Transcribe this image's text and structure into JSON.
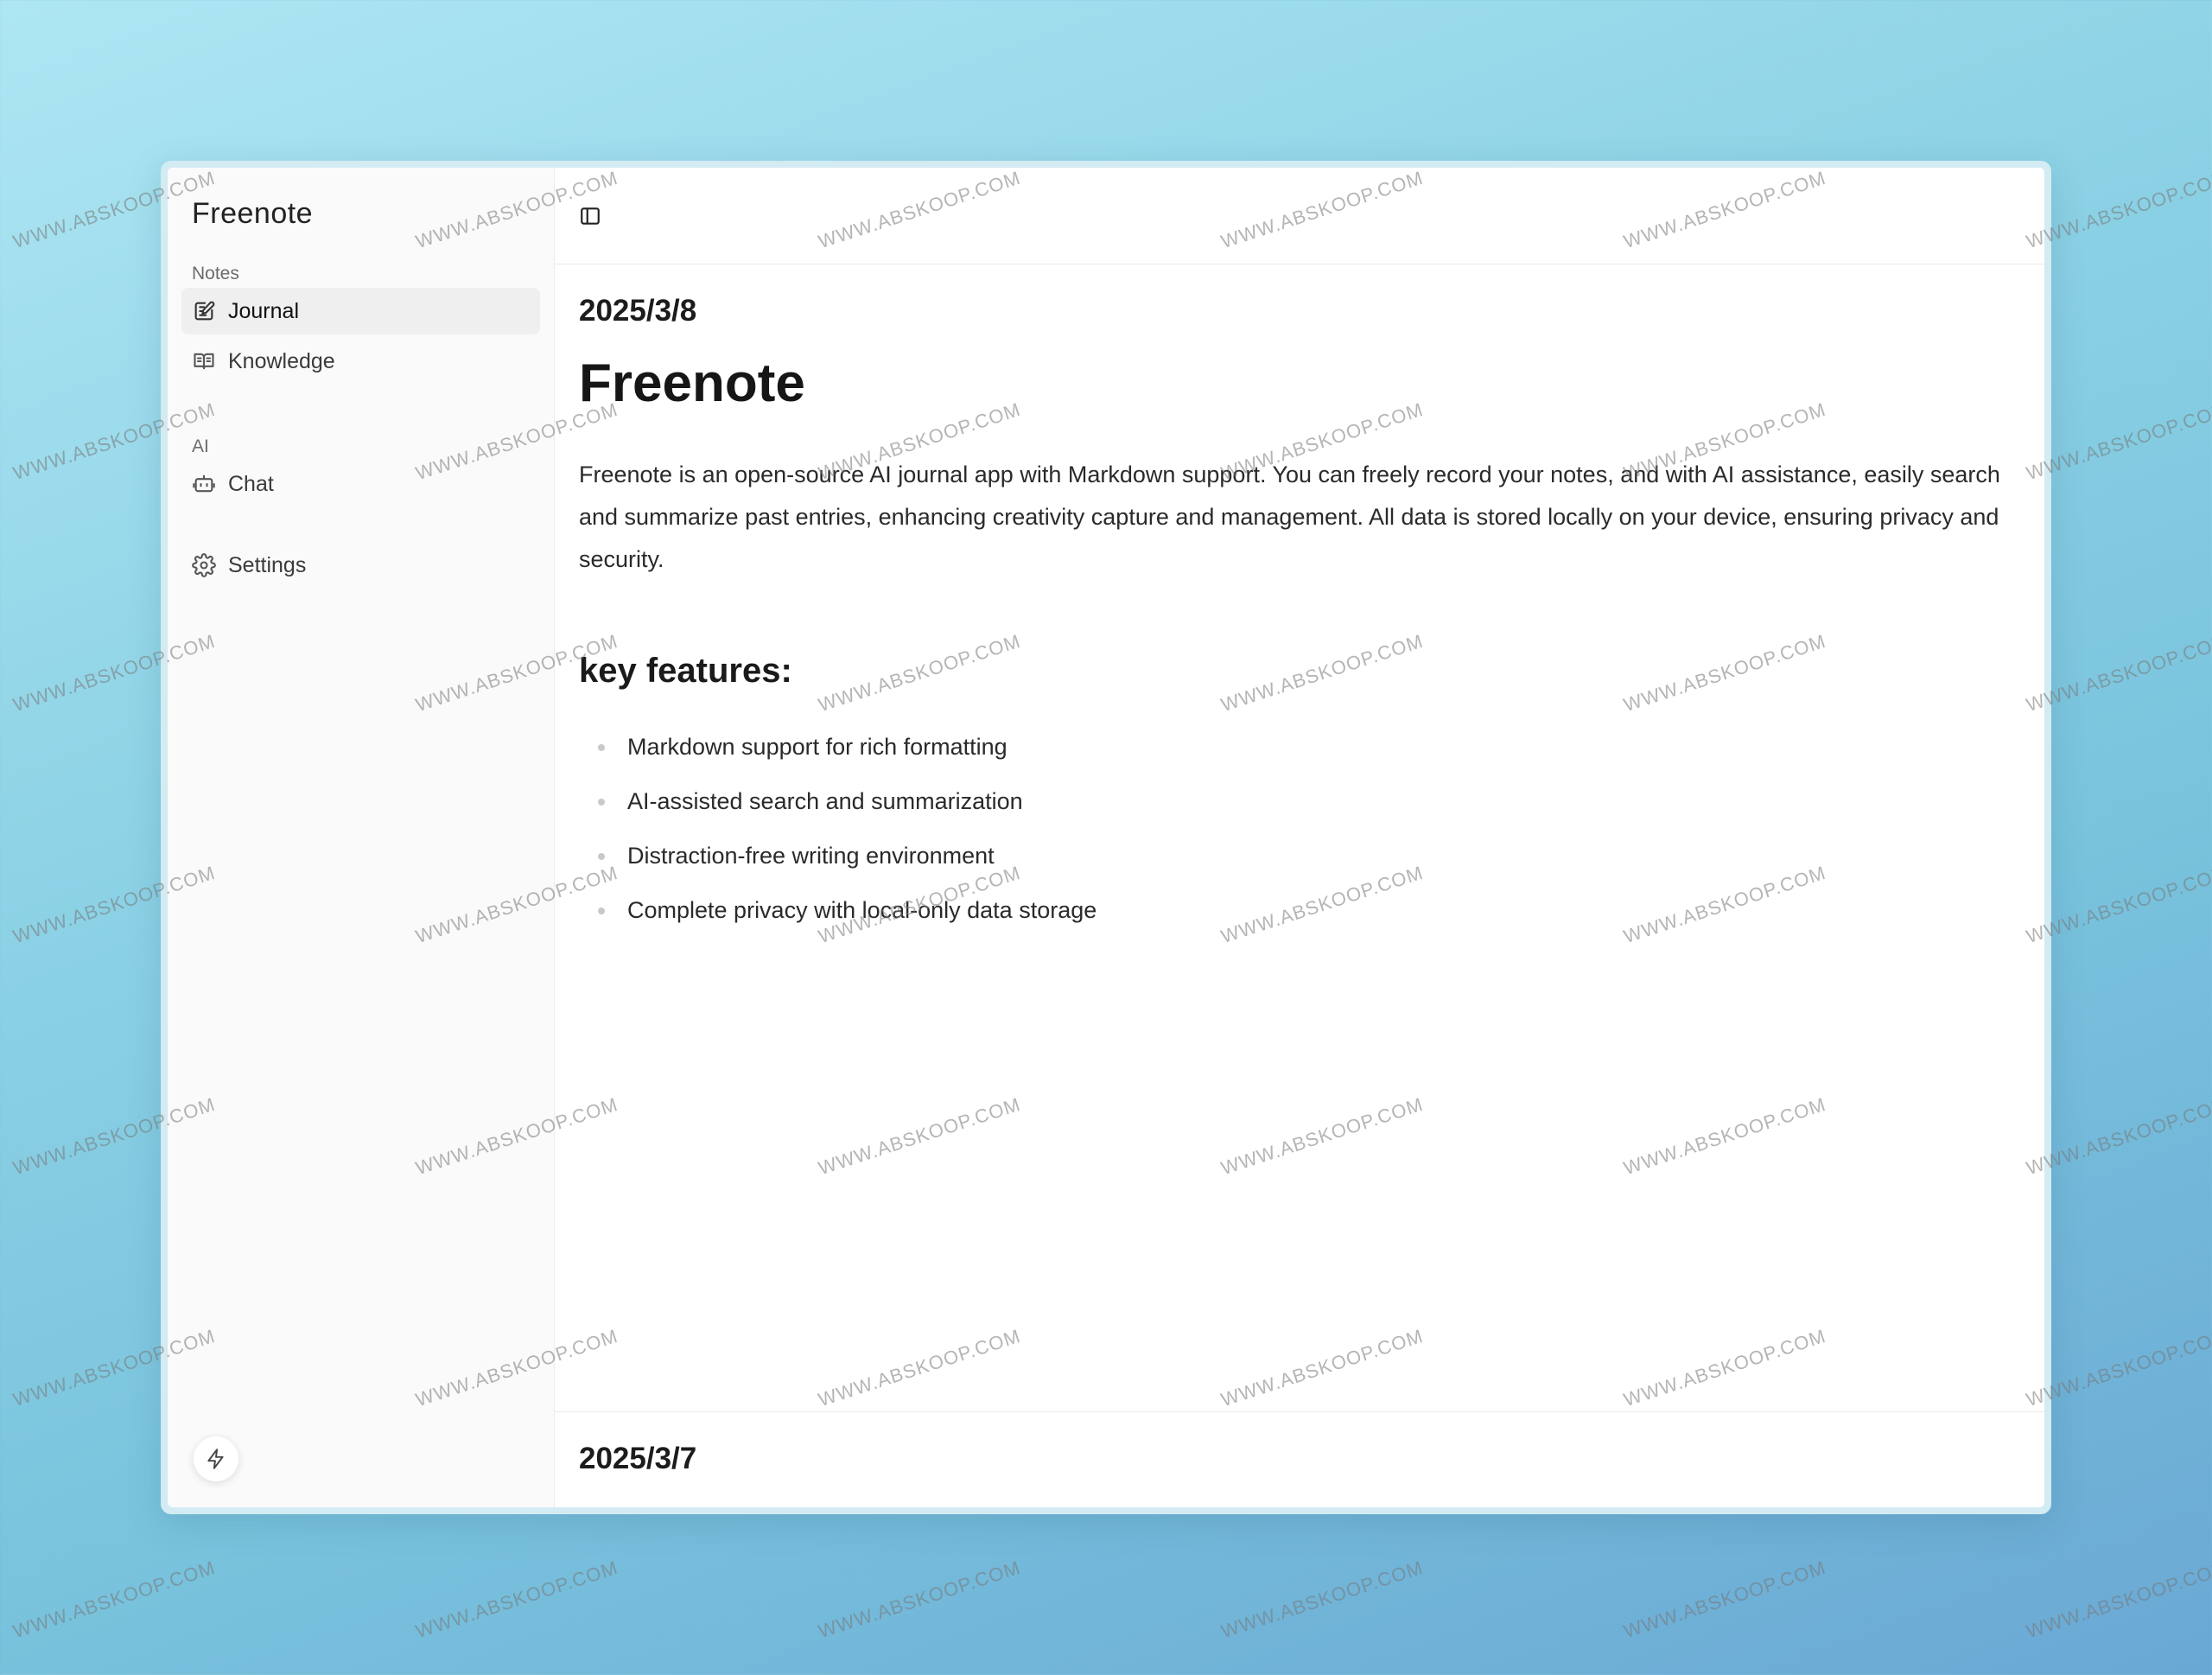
{
  "sidebar": {
    "app_title": "Freenote",
    "sections": {
      "notes_label": "Notes",
      "ai_label": "AI"
    },
    "items": {
      "journal": "Journal",
      "knowledge": "Knowledge",
      "chat": "Chat",
      "settings": "Settings"
    },
    "active_item": "Journal"
  },
  "entries": [
    {
      "date": "2025/3/8",
      "title": "Freenote",
      "body": "Freenote is an open-source AI journal app with Markdown support. You can freely record your notes, and with AI assistance, easily search and summarize past entries, enhancing creativity capture and management. All data is stored locally on your device, ensuring privacy and security.",
      "subheading": "key features:",
      "features": [
        "Markdown support for rich formatting",
        "AI-assisted search and summarization",
        "Distraction-free writing environment",
        "Complete privacy with local-only data storage"
      ]
    },
    {
      "date": "2025/3/7"
    }
  ],
  "watermark": "WWW.ABSKOOP.COM",
  "icons": {
    "toolbar": "sidebar-toggle-icon",
    "journal": "edit-note-icon",
    "knowledge": "book-open-icon",
    "chat": "bot-icon",
    "settings": "gear-icon",
    "bottom": "bolt-icon"
  },
  "colors": {
    "background_top": "#aee6f3",
    "background_bottom": "#6aa8d4",
    "sidebar_bg": "#fafafa",
    "active_item_bg": "#efefef"
  }
}
